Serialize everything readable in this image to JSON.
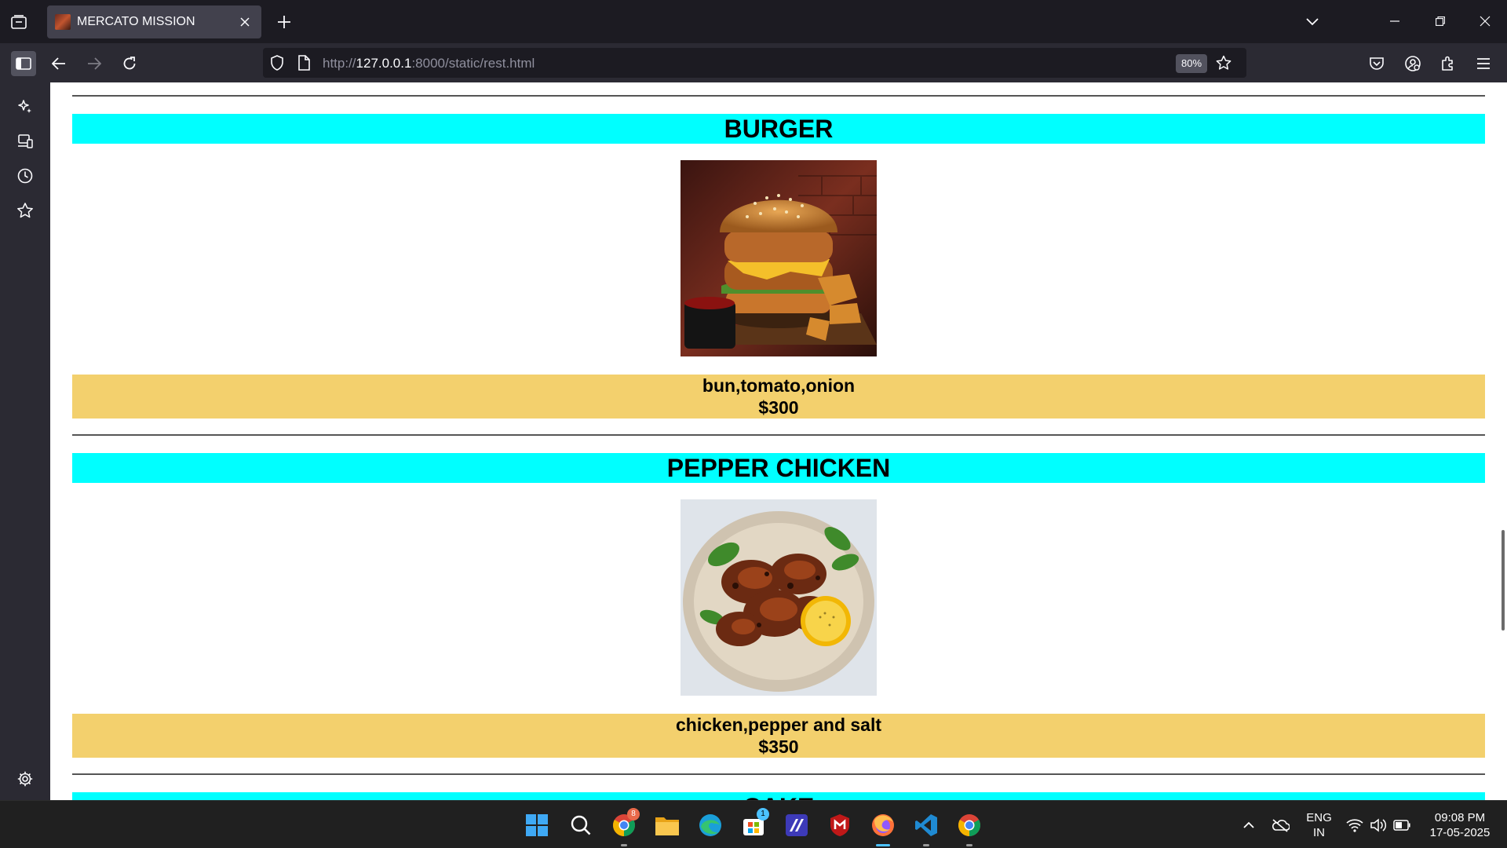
{
  "tab": {
    "title": "MERCATO MISSION"
  },
  "address": {
    "url_prefix": "http://",
    "url_host": "127.0.0.1",
    "url_rest": ":8000/static/rest.html",
    "zoom": "80%"
  },
  "menu": [
    {
      "name": "BURGER",
      "ingredients": "bun,tomato,onion",
      "price": "$300"
    },
    {
      "name": "PEPPER CHICKEN",
      "ingredients": "chicken,pepper and salt",
      "price": "$350"
    },
    {
      "name": "CAKE"
    }
  ],
  "taskbar": {
    "lang_line1": "ENG",
    "lang_line2": "IN",
    "time": "09:08 PM",
    "date": "17-05-2025",
    "chrome_badge": "8",
    "store_badge": "1"
  },
  "colors": {
    "title_bg": "#00ffff",
    "desc_bg": "#f3d06d"
  }
}
